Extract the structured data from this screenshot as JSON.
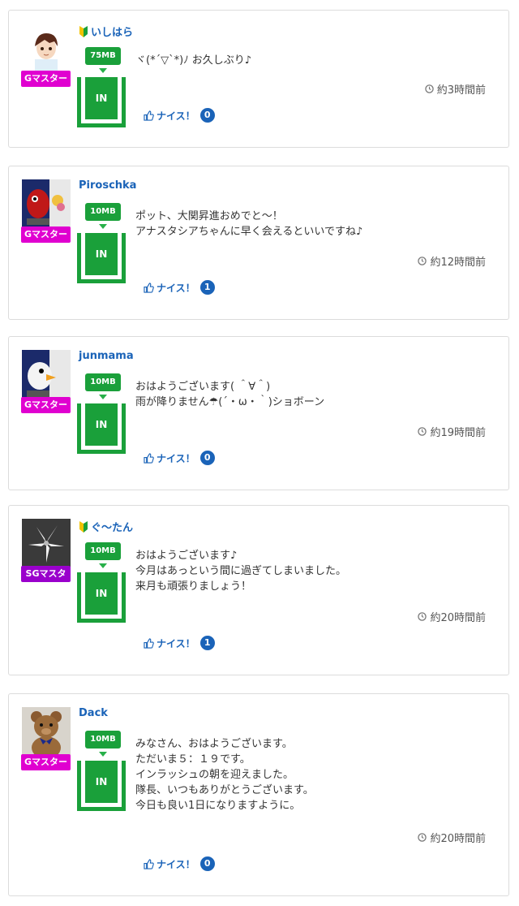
{
  "posts": [
    {
      "user": "いしはら",
      "beginner": true,
      "rank": "Gマスター",
      "rank_color": "#e000d0",
      "avatar": "boy-icon",
      "mb": "75MB",
      "in_label": "IN",
      "message": "ヾ(*´▽`*)ﾉ お久しぶり♪",
      "time": "約3時間前",
      "nice_label": "ナイス！",
      "nice_count": "0"
    },
    {
      "user": "Piroschka",
      "beginner": false,
      "rank": "Gマスター",
      "rank_color": "#e000d0",
      "avatar": "toy-bird-icon",
      "mb": "10MB",
      "in_label": "IN",
      "message": "ポット、大関昇進おめでと～！\nアナスタシアちゃんに早く会えるといいですね♪",
      "time": "約12時間前",
      "nice_label": "ナイス！",
      "nice_count": "1"
    },
    {
      "user": "junmama",
      "beginner": false,
      "rank": "Gマスター",
      "rank_color": "#e000d0",
      "avatar": "toy-bird-icon",
      "mb": "10MB",
      "in_label": "IN",
      "message": "おはようございます( ＾∀＾)\n雨が降りません☂(´・ω・｀)ショボーン",
      "time": "約19時間前",
      "nice_label": "ナイス！",
      "nice_count": "0"
    },
    {
      "user": "ぐ～たん",
      "beginner": true,
      "rank": "SGマスタ",
      "rank_color": "#9a00cc",
      "avatar": "lily-flower-icon",
      "mb": "10MB",
      "in_label": "IN",
      "message": "おはようございます♪\n今月はあっという間に過ぎてしまいました。\n来月も頑張りましょう！",
      "time": "約20時間前",
      "nice_label": "ナイス！",
      "nice_count": "1"
    },
    {
      "user": "Dack",
      "beginner": false,
      "rank": "Gマスター",
      "rank_color": "#e000d0",
      "avatar": "teddy-bear-icon",
      "mb": "10MB",
      "in_label": "IN",
      "message": "みなさん、おはようございます。\nただいま５：１９です。\nインラッシュの朝を迎えました。\n隊長、いつもありがとうございます。\n今日も良い1日になりますように。",
      "time": "約20時間前",
      "nice_label": "ナイス！",
      "nice_count": "0"
    }
  ]
}
